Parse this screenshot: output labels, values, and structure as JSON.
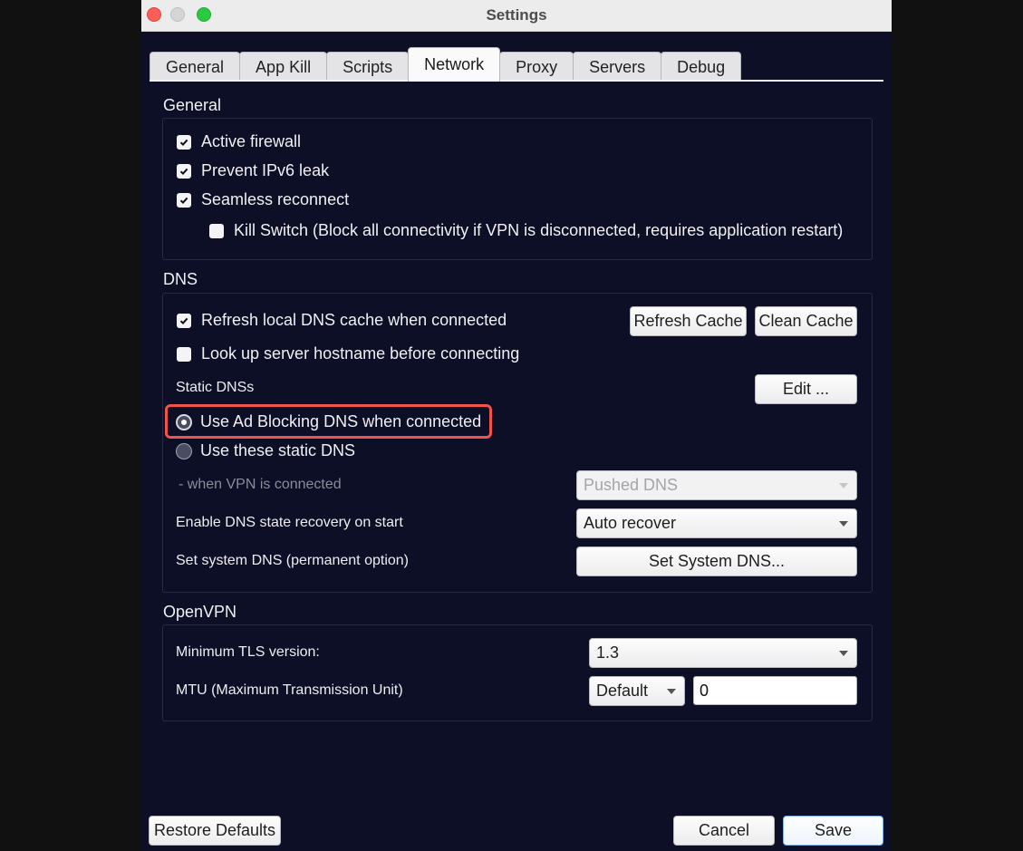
{
  "window": {
    "title": "Settings",
    "traffic_lights": [
      "close",
      "minimize",
      "maximize"
    ]
  },
  "tabs": [
    {
      "label": "General",
      "active": false
    },
    {
      "label": "App Kill",
      "active": false
    },
    {
      "label": "Scripts",
      "active": false
    },
    {
      "label": "Network",
      "active": true
    },
    {
      "label": "Proxy",
      "active": false
    },
    {
      "label": "Servers",
      "active": false
    },
    {
      "label": "Debug",
      "active": false
    }
  ],
  "general": {
    "title": "General",
    "active_firewall": {
      "label": "Active firewall",
      "checked": true
    },
    "prevent_ipv6": {
      "label": "Prevent IPv6 leak",
      "checked": true
    },
    "seamless_reconnect": {
      "label": "Seamless reconnect",
      "checked": true
    },
    "kill_switch": {
      "label": "Kill Switch (Block all connectivity if VPN is disconnected, requires application restart)",
      "checked": false
    }
  },
  "dns": {
    "title": "DNS",
    "refresh_local": {
      "label": "Refresh local DNS cache when connected",
      "checked": true
    },
    "refresh_cache_button": "Refresh Cache",
    "clean_cache_button": "Clean Cache",
    "lookup_hostname": {
      "label": "Look up server hostname before connecting",
      "checked": false
    },
    "static_dnss_label": "Static DNSs",
    "edit_button": "Edit ...",
    "ad_blocking_radio": {
      "label": "Use Ad Blocking DNS when connected",
      "selected": true
    },
    "static_radio": {
      "label": "Use these static DNS",
      "selected": false
    },
    "when_connected_label": "- when VPN is connected",
    "when_connected_select": {
      "value": "Pushed DNS",
      "disabled": true
    },
    "state_recovery_label": "Enable DNS state recovery on start",
    "state_recovery_select": {
      "value": "Auto recover"
    },
    "set_system_label": "Set system DNS (permanent option)",
    "set_system_button": "Set System DNS..."
  },
  "openvpn": {
    "title": "OpenVPN",
    "min_tls_label": "Minimum TLS version:",
    "min_tls_select": {
      "value": "1.3"
    },
    "mtu_label": "MTU (Maximum Transmission Unit)",
    "mtu_select": {
      "value": "Default"
    },
    "mtu_input": {
      "value": "0"
    }
  },
  "footer": {
    "restore_defaults": "Restore Defaults",
    "cancel": "Cancel",
    "save": "Save"
  },
  "highlight": {
    "color": "#f0524c",
    "target": "ad-blocking-radio"
  }
}
